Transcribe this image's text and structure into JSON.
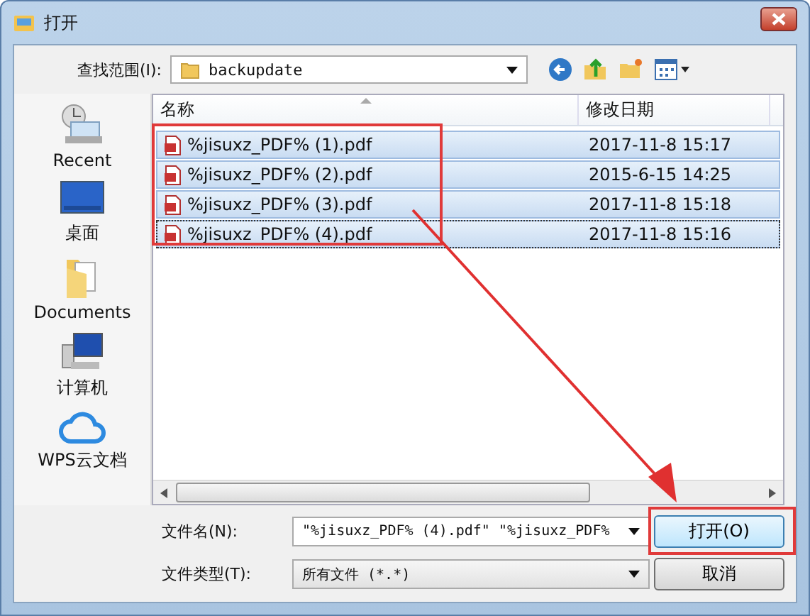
{
  "window": {
    "title": "打开"
  },
  "look_in": {
    "label": "查找范围(I):",
    "value": "backupdate"
  },
  "sidebar": {
    "items": [
      {
        "label": "Recent",
        "kind": "recent"
      },
      {
        "label": "桌面",
        "kind": "desktop"
      },
      {
        "label": "Documents",
        "kind": "documents"
      },
      {
        "label": "计算机",
        "kind": "computer"
      },
      {
        "label": "WPS云文档",
        "kind": "cloud"
      }
    ]
  },
  "table": {
    "columns": [
      "名称",
      "修改日期"
    ],
    "rows": [
      {
        "name": "%jisuxz_PDF% (1).pdf",
        "date": "2017-11-8 15:17",
        "selected": true,
        "focused": false
      },
      {
        "name": "%jisuxz_PDF% (2).pdf",
        "date": "2015-6-15 14:25",
        "selected": true,
        "focused": false
      },
      {
        "name": "%jisuxz_PDF% (3).pdf",
        "date": "2017-11-8 15:18",
        "selected": true,
        "focused": false
      },
      {
        "name": "%jisuxz_PDF% (4).pdf",
        "date": "2017-11-8 15:16",
        "selected": true,
        "focused": true
      }
    ]
  },
  "file_name": {
    "label": "文件名(N):",
    "value": "\"%jisuxz_PDF% (4).pdf\" \"%jisuxz_PDF%"
  },
  "file_type": {
    "label": "文件类型(T):",
    "value": "所有文件 (*.*)"
  },
  "buttons": [
    "打开(O)",
    "取消"
  ]
}
